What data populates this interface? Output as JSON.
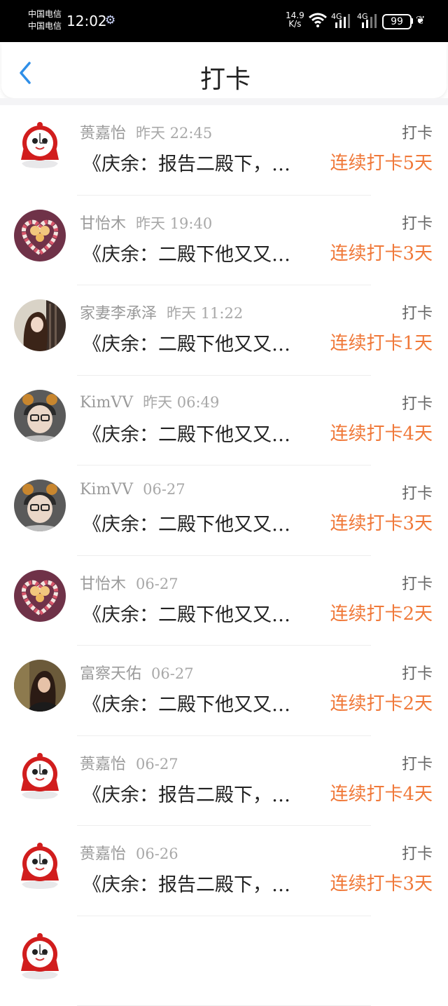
{
  "status_bar": {
    "carrier_1": "中国电信",
    "carrier_2": "中国电信",
    "time": "12:02",
    "speed_value": "14.9",
    "speed_unit": "K/s",
    "network_1": "4G",
    "network_2": "4G",
    "battery": "99"
  },
  "header": {
    "title": "打卡",
    "back_icon": "chevron-left-icon"
  },
  "colors": {
    "accent": "#f07838",
    "back_icon": "#2f8fe8",
    "name_gray": "#9a9a9a"
  },
  "entries": [
    {
      "name": "蒉嘉怡",
      "time": "昨天  22:45",
      "kind": "打卡",
      "book": "《庆余：报告二殿下，…",
      "streak": "连续打卡5天",
      "avatar": "clock-avatar"
    },
    {
      "name": "甘怡木",
      "time": "昨天  19:40",
      "kind": "打卡",
      "book": "《庆余：二殿下他又又…",
      "streak": "连续打卡3天",
      "avatar": "candy-heart-avatar"
    },
    {
      "name": "家妻李承泽",
      "time": "昨天  11:22",
      "kind": "打卡",
      "book": "《庆余：二殿下他又又…",
      "streak": "连续打卡1天",
      "avatar": "girl-photo-avatar"
    },
    {
      "name": "KimVV",
      "time": "昨天  06:49",
      "kind": "打卡",
      "book": "《庆余：二殿下他又又…",
      "streak": "连续打卡4天",
      "avatar": "boy-bear-ears-avatar"
    },
    {
      "name": "KimVV",
      "time": "06-27",
      "kind": "打卡",
      "book": "《庆余：二殿下他又又…",
      "streak": "连续打卡3天",
      "avatar": "boy-bear-ears-avatar"
    },
    {
      "name": "甘怡木",
      "time": "06-27",
      "kind": "打卡",
      "book": "《庆余：二殿下他又又…",
      "streak": "连续打卡2天",
      "avatar": "candy-heart-avatar"
    },
    {
      "name": "富察天佑",
      "time": "06-27",
      "kind": "打卡",
      "book": "《庆余：二殿下他又又…",
      "streak": "连续打卡2天",
      "avatar": "girl-portrait-avatar"
    },
    {
      "name": "蒉嘉怡",
      "time": "06-27",
      "kind": "打卡",
      "book": "《庆余：报告二殿下，…",
      "streak": "连续打卡4天",
      "avatar": "clock-avatar"
    },
    {
      "name": "蒉嘉怡",
      "time": "06-26",
      "kind": "打卡",
      "book": "《庆余：报告二殿下，…",
      "streak": "连续打卡3天",
      "avatar": "clock-avatar"
    },
    {
      "name": "",
      "time": "",
      "kind": "",
      "book": "",
      "streak": "",
      "avatar": "clock-avatar"
    }
  ]
}
